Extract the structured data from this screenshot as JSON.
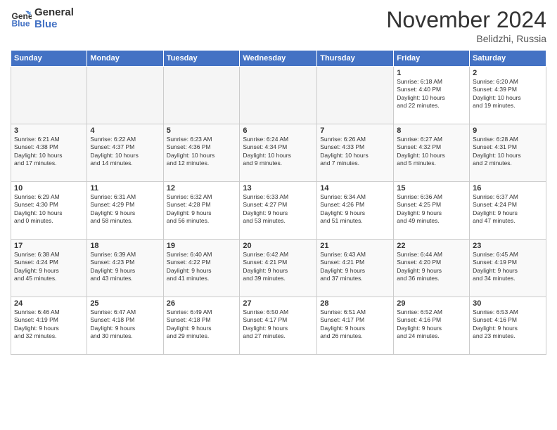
{
  "logo": {
    "line1": "General",
    "line2": "Blue"
  },
  "title": "November 2024",
  "location": "Belidzhi, Russia",
  "days_header": [
    "Sunday",
    "Monday",
    "Tuesday",
    "Wednesday",
    "Thursday",
    "Friday",
    "Saturday"
  ],
  "weeks": [
    [
      {
        "day": "",
        "info": ""
      },
      {
        "day": "",
        "info": ""
      },
      {
        "day": "",
        "info": ""
      },
      {
        "day": "",
        "info": ""
      },
      {
        "day": "",
        "info": ""
      },
      {
        "day": "1",
        "info": "Sunrise: 6:18 AM\nSunset: 4:40 PM\nDaylight: 10 hours\nand 22 minutes."
      },
      {
        "day": "2",
        "info": "Sunrise: 6:20 AM\nSunset: 4:39 PM\nDaylight: 10 hours\nand 19 minutes."
      }
    ],
    [
      {
        "day": "3",
        "info": "Sunrise: 6:21 AM\nSunset: 4:38 PM\nDaylight: 10 hours\nand 17 minutes."
      },
      {
        "day": "4",
        "info": "Sunrise: 6:22 AM\nSunset: 4:37 PM\nDaylight: 10 hours\nand 14 minutes."
      },
      {
        "day": "5",
        "info": "Sunrise: 6:23 AM\nSunset: 4:36 PM\nDaylight: 10 hours\nand 12 minutes."
      },
      {
        "day": "6",
        "info": "Sunrise: 6:24 AM\nSunset: 4:34 PM\nDaylight: 10 hours\nand 9 minutes."
      },
      {
        "day": "7",
        "info": "Sunrise: 6:26 AM\nSunset: 4:33 PM\nDaylight: 10 hours\nand 7 minutes."
      },
      {
        "day": "8",
        "info": "Sunrise: 6:27 AM\nSunset: 4:32 PM\nDaylight: 10 hours\nand 5 minutes."
      },
      {
        "day": "9",
        "info": "Sunrise: 6:28 AM\nSunset: 4:31 PM\nDaylight: 10 hours\nand 2 minutes."
      }
    ],
    [
      {
        "day": "10",
        "info": "Sunrise: 6:29 AM\nSunset: 4:30 PM\nDaylight: 10 hours\nand 0 minutes."
      },
      {
        "day": "11",
        "info": "Sunrise: 6:31 AM\nSunset: 4:29 PM\nDaylight: 9 hours\nand 58 minutes."
      },
      {
        "day": "12",
        "info": "Sunrise: 6:32 AM\nSunset: 4:28 PM\nDaylight: 9 hours\nand 56 minutes."
      },
      {
        "day": "13",
        "info": "Sunrise: 6:33 AM\nSunset: 4:27 PM\nDaylight: 9 hours\nand 53 minutes."
      },
      {
        "day": "14",
        "info": "Sunrise: 6:34 AM\nSunset: 4:26 PM\nDaylight: 9 hours\nand 51 minutes."
      },
      {
        "day": "15",
        "info": "Sunrise: 6:36 AM\nSunset: 4:25 PM\nDaylight: 9 hours\nand 49 minutes."
      },
      {
        "day": "16",
        "info": "Sunrise: 6:37 AM\nSunset: 4:24 PM\nDaylight: 9 hours\nand 47 minutes."
      }
    ],
    [
      {
        "day": "17",
        "info": "Sunrise: 6:38 AM\nSunset: 4:24 PM\nDaylight: 9 hours\nand 45 minutes."
      },
      {
        "day": "18",
        "info": "Sunrise: 6:39 AM\nSunset: 4:23 PM\nDaylight: 9 hours\nand 43 minutes."
      },
      {
        "day": "19",
        "info": "Sunrise: 6:40 AM\nSunset: 4:22 PM\nDaylight: 9 hours\nand 41 minutes."
      },
      {
        "day": "20",
        "info": "Sunrise: 6:42 AM\nSunset: 4:21 PM\nDaylight: 9 hours\nand 39 minutes."
      },
      {
        "day": "21",
        "info": "Sunrise: 6:43 AM\nSunset: 4:21 PM\nDaylight: 9 hours\nand 37 minutes."
      },
      {
        "day": "22",
        "info": "Sunrise: 6:44 AM\nSunset: 4:20 PM\nDaylight: 9 hours\nand 36 minutes."
      },
      {
        "day": "23",
        "info": "Sunrise: 6:45 AM\nSunset: 4:19 PM\nDaylight: 9 hours\nand 34 minutes."
      }
    ],
    [
      {
        "day": "24",
        "info": "Sunrise: 6:46 AM\nSunset: 4:19 PM\nDaylight: 9 hours\nand 32 minutes."
      },
      {
        "day": "25",
        "info": "Sunrise: 6:47 AM\nSunset: 4:18 PM\nDaylight: 9 hours\nand 30 minutes."
      },
      {
        "day": "26",
        "info": "Sunrise: 6:49 AM\nSunset: 4:18 PM\nDaylight: 9 hours\nand 29 minutes."
      },
      {
        "day": "27",
        "info": "Sunrise: 6:50 AM\nSunset: 4:17 PM\nDaylight: 9 hours\nand 27 minutes."
      },
      {
        "day": "28",
        "info": "Sunrise: 6:51 AM\nSunset: 4:17 PM\nDaylight: 9 hours\nand 26 minutes."
      },
      {
        "day": "29",
        "info": "Sunrise: 6:52 AM\nSunset: 4:16 PM\nDaylight: 9 hours\nand 24 minutes."
      },
      {
        "day": "30",
        "info": "Sunrise: 6:53 AM\nSunset: 4:16 PM\nDaylight: 9 hours\nand 23 minutes."
      }
    ]
  ]
}
